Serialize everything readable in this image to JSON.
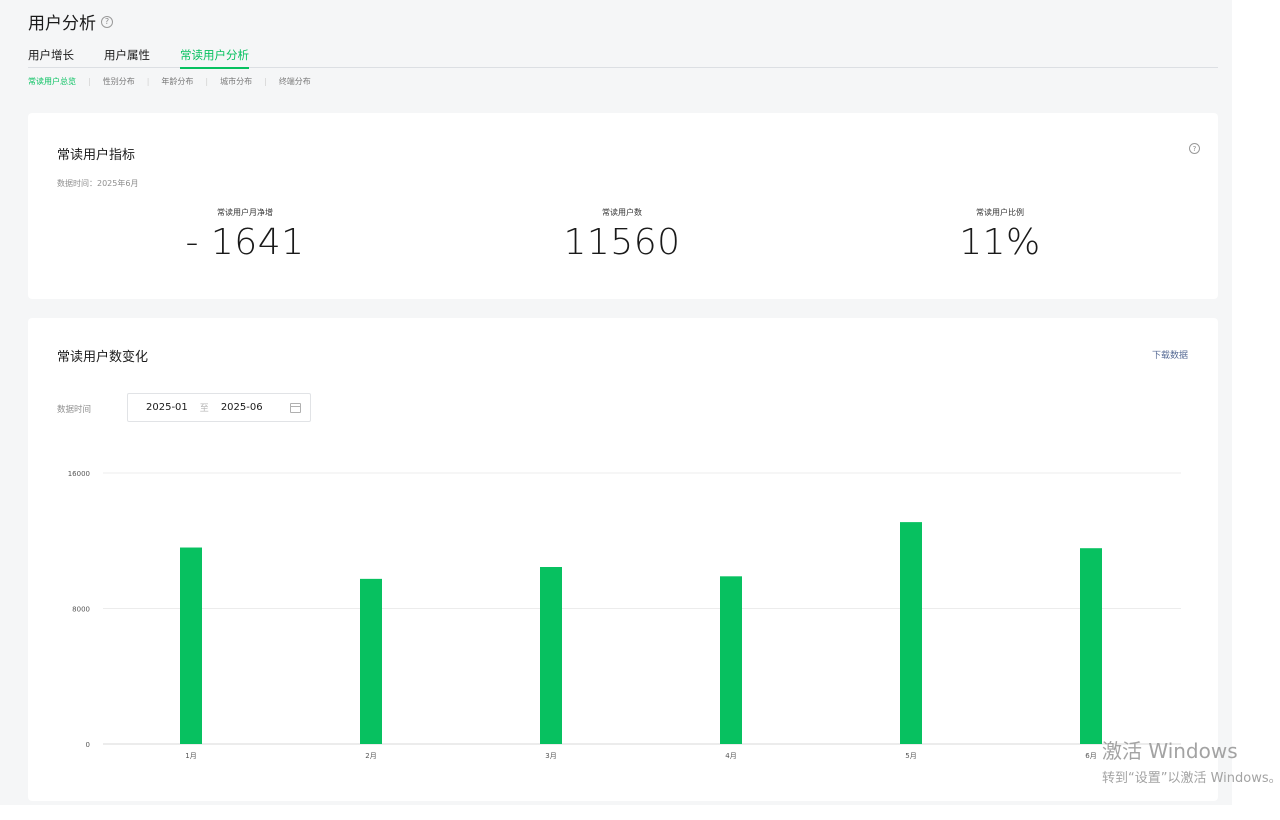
{
  "page": {
    "title": "用户分析"
  },
  "tabs": [
    {
      "label": "用户增长",
      "active": false
    },
    {
      "label": "用户属性",
      "active": false
    },
    {
      "label": "常读用户分析",
      "active": true
    }
  ],
  "subtabs": [
    {
      "label": "常读用户总览",
      "active": true
    },
    {
      "label": "性别分布",
      "active": false
    },
    {
      "label": "年龄分布",
      "active": false
    },
    {
      "label": "城市分布",
      "active": false
    },
    {
      "label": "终端分布",
      "active": false
    }
  ],
  "metrics_card": {
    "title": "常读用户指标",
    "data_time": "数据时间：2025年6月",
    "metrics": [
      {
        "label": "常读用户月净增",
        "value": "- 1641"
      },
      {
        "label": "常读用户数",
        "value": "11560"
      },
      {
        "label": "常读用户比例",
        "value": "11%"
      }
    ]
  },
  "chart_card": {
    "title": "常读用户数变化",
    "download_label": "下载数据",
    "date_label": "数据时间",
    "date_start": "2025-01",
    "date_sep": "至",
    "date_end": "2025-06"
  },
  "chart_data": {
    "type": "bar",
    "categories": [
      "1月",
      "2月",
      "3月",
      "4月",
      "5月",
      "6月"
    ],
    "values": [
      11600,
      9750,
      10450,
      9900,
      13100,
      11560
    ],
    "ylim": [
      0,
      16000
    ],
    "yticks": [
      "0",
      "8000",
      "16000"
    ],
    "ytick_values": [
      0,
      8000,
      16000
    ],
    "color": "#07c160",
    "grid": true
  },
  "watermark": {
    "line1": "激活 Windows",
    "line2": "转到“设置”以激活 Windows。"
  },
  "colors": {
    "accent": "#07c160",
    "link": "#576b95",
    "background": "#f5f6f7"
  }
}
